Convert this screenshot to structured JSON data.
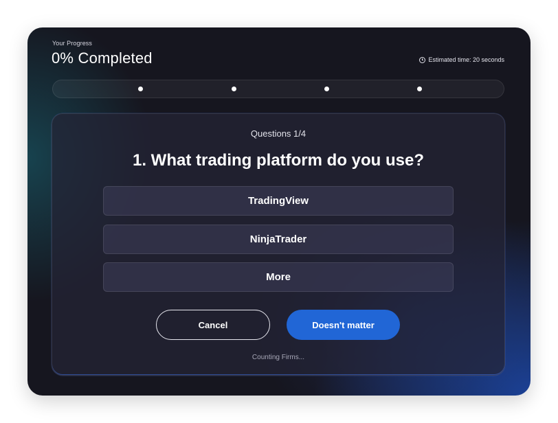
{
  "progress": {
    "caption": "Your Progress",
    "title": "0% Completed",
    "percent_complete": 0,
    "estimated_time": "Estimated time: 20 seconds",
    "step_count": 4
  },
  "question": {
    "counter": "Questions 1/4",
    "title": "1. What trading platform do you use?",
    "options": [
      {
        "label": "TradingView"
      },
      {
        "label": "NinjaTrader"
      },
      {
        "label": "More"
      }
    ]
  },
  "actions": {
    "cancel_label": "Cancel",
    "doesnt_matter_label": "Doesn't matter"
  },
  "footer": {
    "note": "Counting Firms..."
  },
  "colors": {
    "accent": "#2166d6",
    "background": "#16161f",
    "card": "#242436"
  },
  "icons": {
    "estimated_time": "clock-icon"
  }
}
